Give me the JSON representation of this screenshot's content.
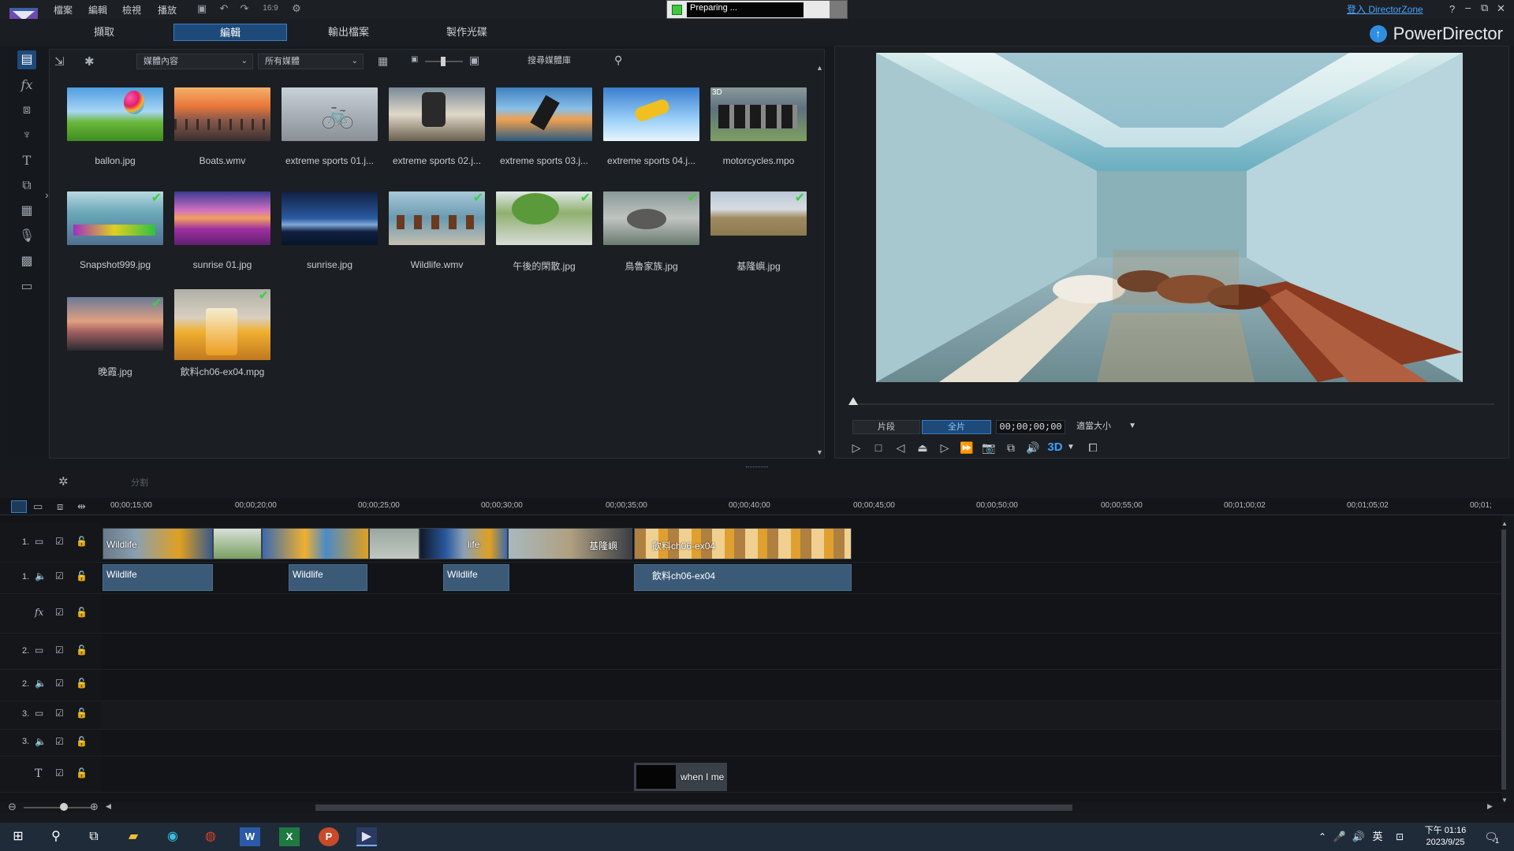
{
  "menu": [
    "檔案",
    "編輯",
    "檢視",
    "播放"
  ],
  "toolbar": {
    "aspect_ratio": "16:9"
  },
  "status": {
    "preparing_text": "Preparing ..."
  },
  "title_bar": {
    "login_link": "登入 DirectorZone",
    "help": "?",
    "minimize": "–",
    "restore": "⧉",
    "close": "✕"
  },
  "modes": [
    "擷取",
    "編輯",
    "輸出檔案",
    "製作光碟"
  ],
  "active_mode": "編輯",
  "brand": "PowerDirector",
  "library": {
    "dropdown_content": "媒體內容",
    "dropdown_filter": "所有媒體",
    "search_placeholder": "搜尋媒體庫",
    "items": [
      {
        "name": "ballon.jpg",
        "checked": false
      },
      {
        "name": "Boats.wmv",
        "checked": false
      },
      {
        "name": "extreme sports 01.j...",
        "checked": false
      },
      {
        "name": "extreme sports 02.j...",
        "checked": false
      },
      {
        "name": "extreme sports 03.j...",
        "checked": false
      },
      {
        "name": "extreme sports 04.j...",
        "checked": false
      },
      {
        "name": "motorcycles.mpo",
        "checked": false,
        "tag": "3D"
      },
      {
        "name": "Snapshot999.jpg",
        "checked": true
      },
      {
        "name": "sunrise 01.jpg",
        "checked": false
      },
      {
        "name": "sunrise.jpg",
        "checked": false
      },
      {
        "name": "Wildlife.wmv",
        "checked": true
      },
      {
        "name": "午後的閑散.jpg",
        "checked": true
      },
      {
        "name": "鳥魯家族.jpg",
        "checked": true
      },
      {
        "name": "基隆嶼.jpg",
        "checked": true
      },
      {
        "name": "晚霞.jpg",
        "checked": true
      },
      {
        "name": "飲料ch06-ex04.mpg",
        "checked": true
      }
    ]
  },
  "preview": {
    "btn_clip": "片段",
    "btn_movie": "全片",
    "timecode": "00;00;00;00",
    "fit_label": "適當大小",
    "three_d": "3D"
  },
  "timeline": {
    "split_label": "分割",
    "ruler": [
      "00;00;15;00",
      "00;00;20;00",
      "00;00;25;00",
      "00;00;30;00",
      "00;00;35;00",
      "00;00;40;00",
      "00;00;45;00",
      "00;00;50;00",
      "00;00;55;00",
      "00;01;00;02",
      "00;01;05;02",
      "00;01;"
    ],
    "track_numbers": [
      "1.",
      "1.",
      "",
      "2.",
      "2.",
      "3.",
      "3.",
      ""
    ],
    "video_clips": [
      "Wildlife",
      "life",
      "基隆嶼",
      "飲料ch06-ex04"
    ],
    "audio_clips": [
      "Wildlife",
      "Wildlife",
      "Wildlife",
      "飲料ch06-ex04"
    ],
    "title_clip": "when I me"
  },
  "taskbar": {
    "time": "下午 01:16",
    "date": "2023/9/25",
    "lang": "英",
    "notif_count": "1"
  },
  "colors": {
    "accent": "#2f8ee0",
    "check": "#3bd23b",
    "active_tab": "#1e4a7a"
  }
}
